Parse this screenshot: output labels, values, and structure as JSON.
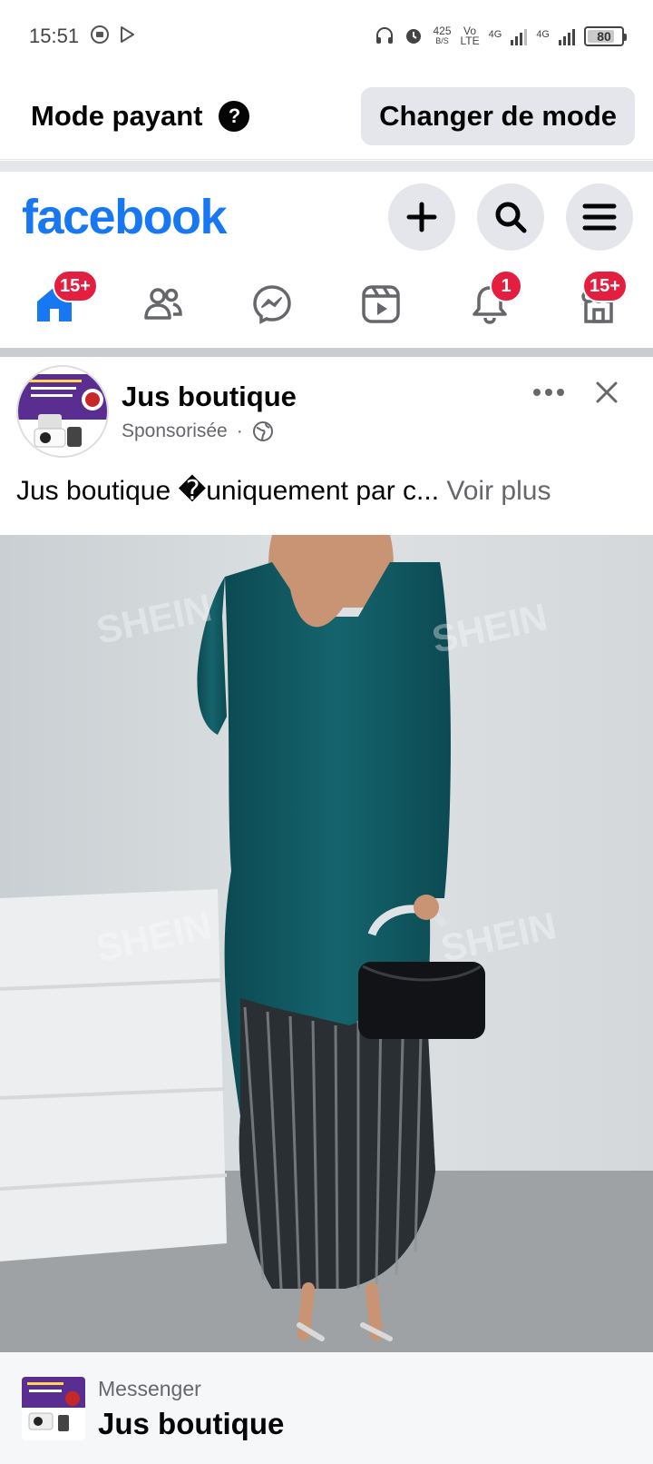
{
  "status_bar": {
    "time": "15:51",
    "net_speed": "425",
    "net_speed_unit": "B/S",
    "volte_top": "Vo",
    "volte_bottom": "LTE",
    "signal1_label": "4G",
    "signal2_label": "4G",
    "battery": "80",
    "battery_level": 0.8
  },
  "mode_bar": {
    "title": "Mode payant",
    "help": "?",
    "button_label": "Changer de mode"
  },
  "header": {
    "logo": "facebook",
    "colors": {
      "brand": "#1877f2",
      "badge": "#e41e3f"
    }
  },
  "nav": {
    "tabs": [
      {
        "name": "home",
        "icon": "home-icon",
        "badge": "15+"
      },
      {
        "name": "friends",
        "icon": "friends-icon",
        "badge": ""
      },
      {
        "name": "messenger",
        "icon": "messenger-icon",
        "badge": ""
      },
      {
        "name": "video",
        "icon": "video-icon",
        "badge": ""
      },
      {
        "name": "notifications",
        "icon": "bell-icon",
        "badge": "1"
      },
      {
        "name": "marketplace",
        "icon": "marketplace-icon",
        "badge": "15+"
      }
    ]
  },
  "post": {
    "author": "Jus boutique",
    "sponsored": "Sponsorisée",
    "dot": "·",
    "text": "Jus boutique �uniquement par c...",
    "see_more": "Voir plus",
    "watermark": "SHEIN"
  },
  "messenger_strip": {
    "app": "Messenger",
    "name": "Jus boutique"
  }
}
